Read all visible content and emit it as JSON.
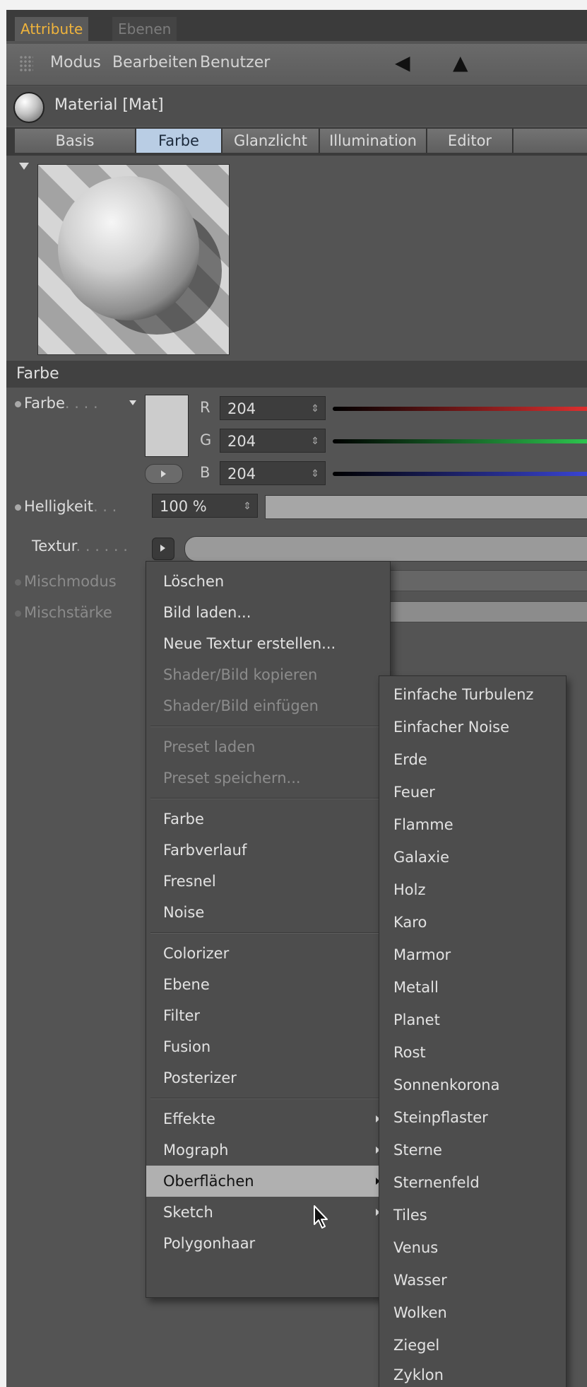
{
  "tabs": {
    "attribute": "Attribute",
    "ebenen": "Ebenen"
  },
  "menubar": {
    "items": [
      "Modus",
      "Bearbeiten",
      "Benutzer"
    ]
  },
  "material": {
    "name": "Material [Mat]"
  },
  "subtabs": [
    "Basis",
    "Farbe",
    "Glanzlicht",
    "Illumination",
    "Editor"
  ],
  "active_subtab": "Farbe",
  "section": {
    "title": "Farbe"
  },
  "params": {
    "farbe": {
      "label": "Farbe",
      "dots": ". . . .",
      "r_label": "R",
      "g_label": "G",
      "b_label": "B",
      "r": "204",
      "g": "204",
      "b": "204",
      "swatch": "#cccccc"
    },
    "helligkeit": {
      "label": "Helligkeit",
      "dots": ". . .",
      "value": "100 %",
      "level": 1.0
    },
    "textur": {
      "label": "Textur",
      "dots": ". . . . . ."
    },
    "mischmodus": {
      "label": "Mischmodus"
    },
    "mischstaerke": {
      "label": "Mischstärke"
    }
  },
  "context_menu": {
    "items": [
      {
        "label": "Löschen",
        "enabled": true
      },
      {
        "label": "Bild laden...",
        "enabled": true
      },
      {
        "label": "Neue Textur erstellen...",
        "enabled": true
      },
      {
        "label": "Shader/Bild kopieren",
        "enabled": false
      },
      {
        "label": "Shader/Bild einfügen",
        "enabled": false
      },
      {
        "label": "Preset laden",
        "enabled": false
      },
      {
        "label": "Preset speichern...",
        "enabled": false
      },
      {
        "label": "Farbe",
        "enabled": true
      },
      {
        "label": "Farbverlauf",
        "enabled": true
      },
      {
        "label": "Fresnel",
        "enabled": true
      },
      {
        "label": "Noise",
        "enabled": true
      },
      {
        "label": "Colorizer",
        "enabled": true
      },
      {
        "label": "Ebene",
        "enabled": true
      },
      {
        "label": "Filter",
        "enabled": true
      },
      {
        "label": "Fusion",
        "enabled": true
      },
      {
        "label": "Posterizer",
        "enabled": true
      },
      {
        "label": "Effekte",
        "enabled": true,
        "submenu": true
      },
      {
        "label": "Mograph",
        "enabled": true,
        "submenu": true
      },
      {
        "label": "Oberflächen",
        "enabled": true,
        "submenu": true,
        "highlighted": true
      },
      {
        "label": "Sketch",
        "enabled": true,
        "submenu": true
      },
      {
        "label": "Polygonhaar",
        "enabled": true
      }
    ]
  },
  "submenu": {
    "items": [
      "Einfache Turbulenz",
      "Einfacher Noise",
      "Erde",
      "Feuer",
      "Flamme",
      "Galaxie",
      "Holz",
      "Karo",
      "Marmor",
      "Metall",
      "Planet",
      "Rost",
      "Sonnenkorona",
      "Steinpflaster",
      "Sterne",
      "Sternenfeld",
      "Tiles",
      "Venus",
      "Wasser",
      "Wolken",
      "Ziegel",
      "Zyklon"
    ]
  },
  "icons": {
    "back": "back-arrow-icon",
    "up": "up-arrow-icon",
    "material": "material-sphere-icon",
    "cursor": "mouse-pointer-icon"
  },
  "colors": {
    "accent_tab": "#f0b43c",
    "active_subtab": "#b9cde4",
    "highlight": "#b0b0b0"
  }
}
